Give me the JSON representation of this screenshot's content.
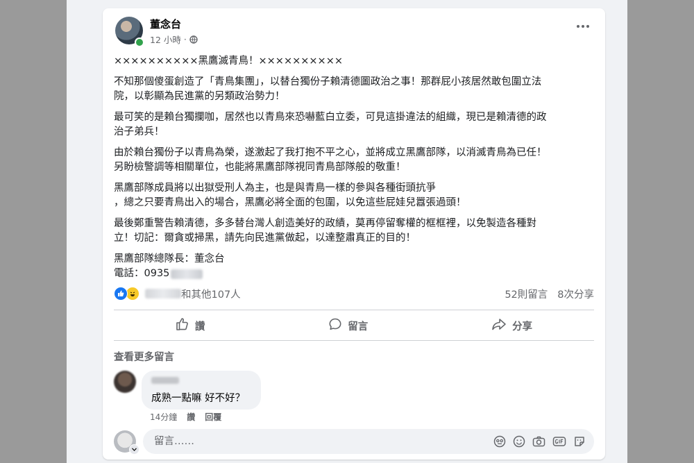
{
  "post": {
    "author": "董念台",
    "time": "12 小時",
    "separator": "·",
    "paragraphs": [
      "××××××××××黑鷹滅青鳥！××××××××××",
      "不知那個傻蛋創造了「青鳥集團」，以替台獨份子賴清德圖政治之事！那群屁小孩居然敢包圍立法\n院，以彰顯為民進黨的另類政治勢力！",
      "最可笑的是賴台獨攔咖，居然也以青鳥來恐嚇藍白立委，可見這掛違法的組織，現已是賴清德的政\n治子弟兵！",
      "由於賴台獨份子以青鳥為榮，遂激起了我打抱不平之心，並將成立黑鷹部隊，以消滅青鳥為已任！\n另盼檢警調等相關單位，也能將黑鷹部隊視同青鳥部隊般的敬重！",
      "黑鷹部隊成員將以出獄受刑人為主，也是與青鳥一樣的參與各種街頭抗爭\n，總之只要青鳥出入的場合，黑鷹必將全面的包圍，以免這些屁娃兒囂張過頭！",
      "最後鄭重警告賴清德，多多替台灣人創造美好的政績，莫再停留奪權的框框裡，以免製造各種對\n立！切記：爾貪或掃黑，請先向民進黨做起，以達整肅真正的目的！"
    ],
    "signature": "黑鷹部隊總隊長：董念台",
    "phone_label": "電話：0935"
  },
  "stats": {
    "reactions_text": "和其他107人",
    "comments": "52則留言",
    "shares": "8次分享"
  },
  "actions": {
    "like": "讚",
    "comment": "留言",
    "share": "分享"
  },
  "comments": {
    "view_more": "查看更多留言",
    "items": [
      {
        "text": "成熟一點嘛 好不好？",
        "time": "14分鐘",
        "like": "讚",
        "reply": "回覆"
      }
    ]
  },
  "composer": {
    "placeholder": "留言……"
  }
}
